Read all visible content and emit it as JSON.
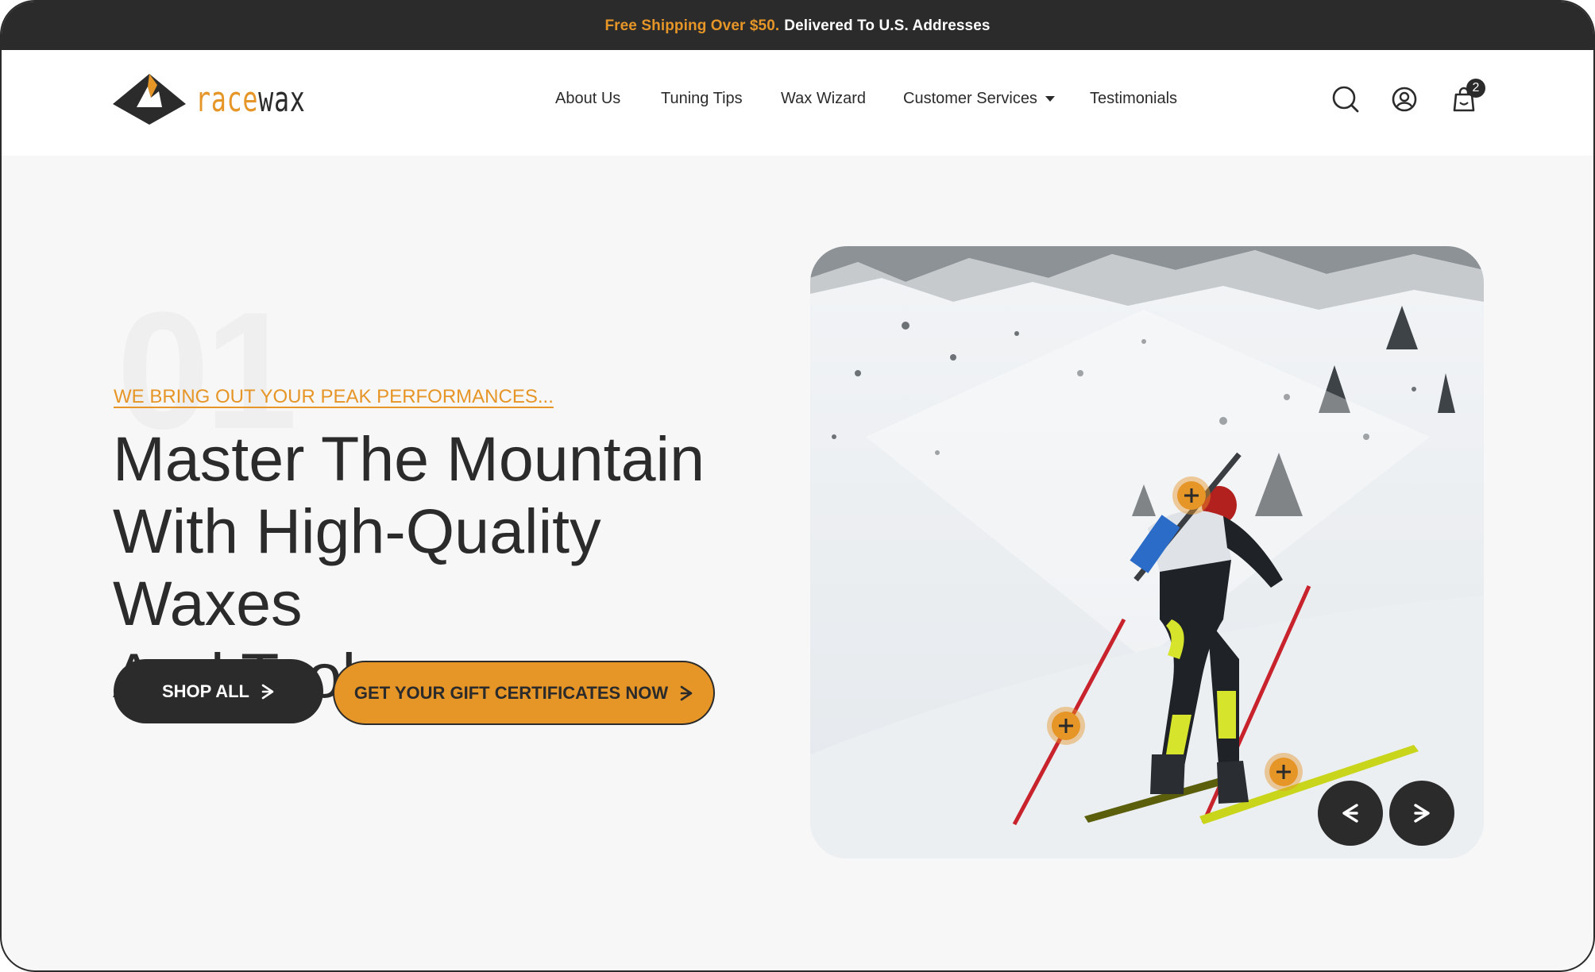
{
  "announcement": {
    "accent_text": "Free Shipping Over $50.",
    "text": "Delivered To U.S. Addresses"
  },
  "brand": {
    "logo_part1": "race",
    "logo_part2": "wax",
    "accent_color": "#e69527",
    "dark_color": "#2b2b2b"
  },
  "nav": {
    "items": [
      {
        "label": "About Us"
      },
      {
        "label": "Tuning Tips"
      },
      {
        "label": "Wax Wizard"
      },
      {
        "label": "Customer Services",
        "has_dropdown": true
      },
      {
        "label": "Testimonials"
      }
    ]
  },
  "header_icons": {
    "search": "search-icon",
    "account": "user-icon",
    "cart": "cart-icon",
    "cart_count": "2"
  },
  "hero": {
    "slide_number": "01",
    "kicker": "We bring out your peak performances...",
    "headline_line1": "Master The Mountain",
    "headline_line2": "With High-Quality Waxes",
    "headline_line3": "And Tools.",
    "primary_button": "Shop All",
    "secondary_button": "Get Your Gift Certificates Now"
  },
  "carousel": {
    "prev_icon": "chevron-left-icon",
    "next_icon": "chevron-right-icon"
  }
}
